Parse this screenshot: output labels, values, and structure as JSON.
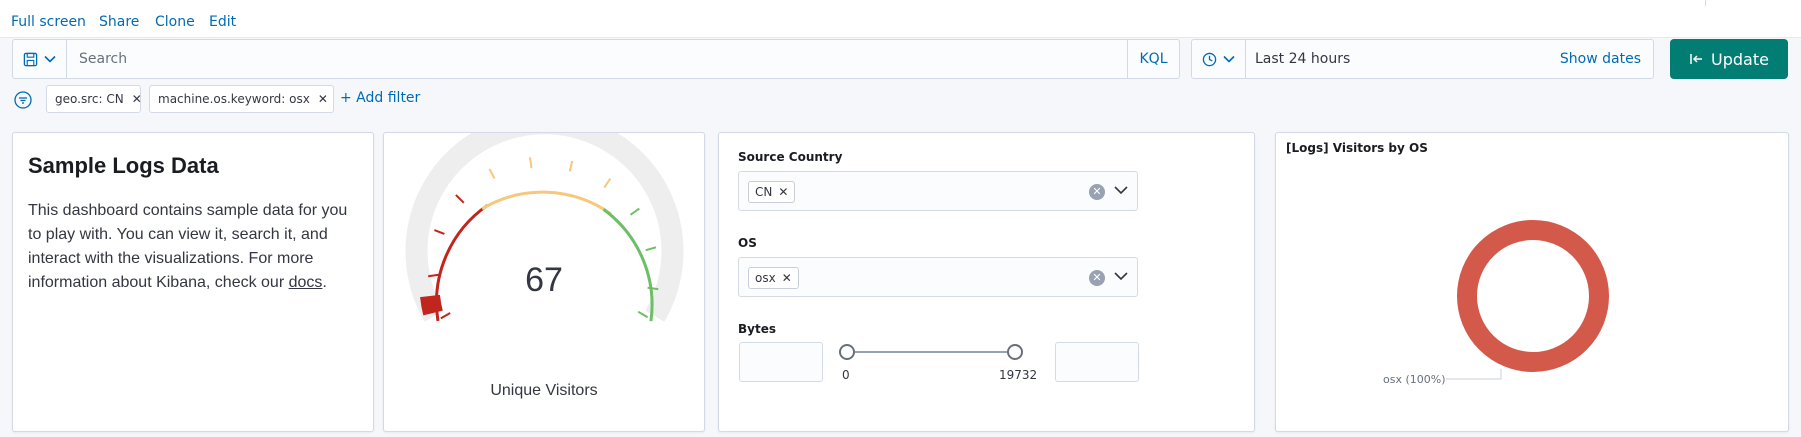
{
  "top_links": [
    "Full screen",
    "Share",
    "Clone",
    "Edit"
  ],
  "query": {
    "placeholder": "Search",
    "language": "KQL"
  },
  "time": {
    "range": "Last 24 hours",
    "show_dates": "Show dates"
  },
  "update_button": {
    "label": "Update",
    "color": "#017d73"
  },
  "filters": {
    "pills": [
      {
        "label": "geo.src: CN"
      },
      {
        "label": "machine.os.keyword: osx"
      }
    ],
    "add_label": "+ Add filter"
  },
  "markdown_panel": {
    "title": "Sample Logs Data",
    "body": "This dashboard contains sample data for you to play with. You can view it, search it, and interact with the visualizations. For more information about Kibana, check our",
    "link": "docs",
    "after_link": "."
  },
  "gauge_panel": {
    "value": "67",
    "label": "Unique Visitors",
    "range_colors": [
      "#c0261d",
      "#f7c77b",
      "#6dbf67"
    ],
    "marker_color": "#c0261d"
  },
  "controls_panel": {
    "source_country": {
      "label": "Source Country",
      "selected": "CN"
    },
    "os": {
      "label": "OS",
      "selected": "osx"
    },
    "bytes": {
      "label": "Bytes",
      "min": "0",
      "max": "19732"
    }
  },
  "pie_panel": {
    "title": "[Logs] Visitors by OS",
    "slice_label": "osx (100%)",
    "slice_color": "#d35a4a"
  },
  "chart_data": {
    "type": "pie",
    "categories": [
      "osx"
    ],
    "values": [
      100
    ],
    "title": "[Logs] Visitors by OS",
    "donut": true
  }
}
